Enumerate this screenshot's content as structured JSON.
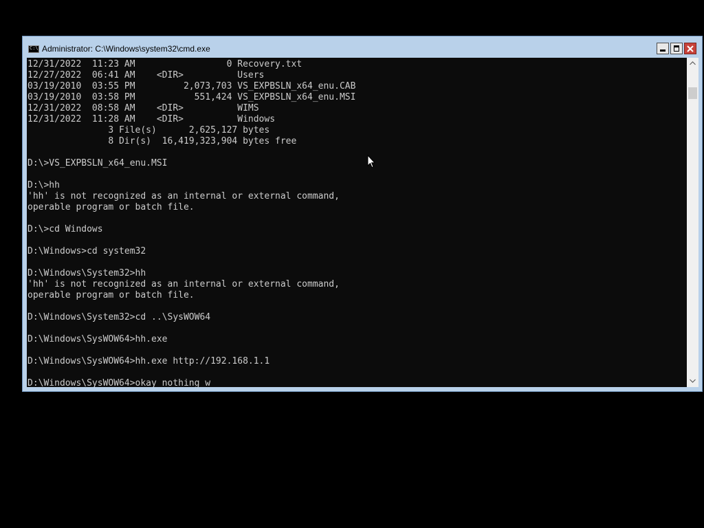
{
  "window": {
    "title": "Administrator: C:\\Windows\\system32\\cmd.exe",
    "icon": "cmd-icon",
    "icon_glyph": "C:\\",
    "buttons": {
      "minimize": "minimize-icon",
      "maximize": "maximize-icon",
      "close": "close-icon"
    }
  },
  "colors": {
    "console_background": "#0c0c0c",
    "console_text": "#cccccc",
    "titlebar": "#b9d1ea",
    "close_button": "#c7423a",
    "desktop": "#000000"
  },
  "console": {
    "lines": [
      "12/31/2022  11:23 AM                 0 Recovery.txt",
      "12/27/2022  06:41 AM    <DIR>          Users",
      "03/19/2010  03:55 PM         2,073,703 VS_EXPBSLN_x64_enu.CAB",
      "03/19/2010  03:58 PM           551,424 VS_EXPBSLN_x64_enu.MSI",
      "12/31/2022  08:58 AM    <DIR>          WIMS",
      "12/31/2022  11:28 AM    <DIR>          Windows",
      "               3 File(s)      2,625,127 bytes",
      "               8 Dir(s)  16,419,323,904 bytes free",
      "",
      "D:\\>VS_EXPBSLN_x64_enu.MSI",
      "",
      "D:\\>hh",
      "'hh' is not recognized as an internal or external command,",
      "operable program or batch file.",
      "",
      "D:\\>cd Windows",
      "",
      "D:\\Windows>cd system32",
      "",
      "D:\\Windows\\System32>hh",
      "'hh' is not recognized as an internal or external command,",
      "operable program or batch file.",
      "",
      "D:\\Windows\\System32>cd ..\\SysWOW64",
      "",
      "D:\\Windows\\SysWOW64>hh.exe",
      "",
      "D:\\Windows\\SysWOW64>hh.exe http://192.168.1.1",
      "",
      "D:\\Windows\\SysWOW64>okay nothing w"
    ]
  },
  "scrollbar": {
    "up_icon": "scroll-up-arrow-icon",
    "down_icon": "scroll-down-arrow-icon"
  },
  "pointer": "mouse-pointer-icon"
}
